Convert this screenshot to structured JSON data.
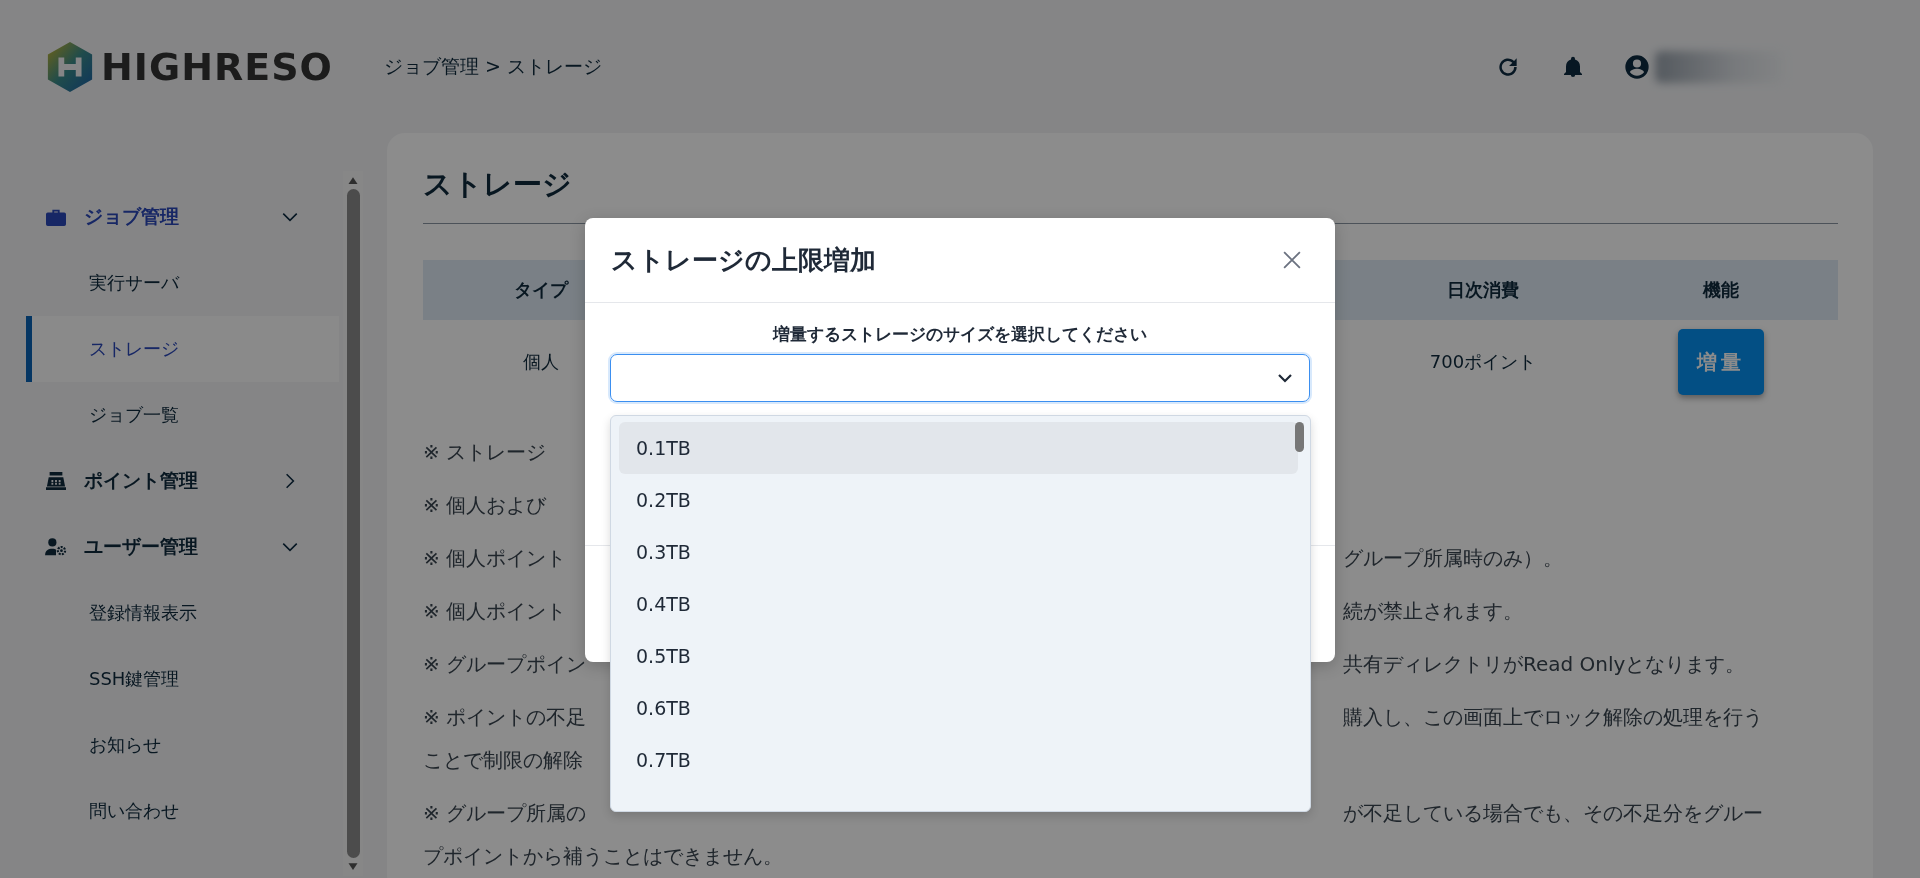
{
  "header": {
    "logo": "HIGHRESO",
    "breadcrumb": "ジョブ管理 > ストレージ"
  },
  "sidebar": {
    "groups": [
      {
        "label": "ジョブ管理",
        "expanded": true,
        "children": [
          {
            "label": "実行サーバ",
            "selected": false
          },
          {
            "label": "ストレージ",
            "selected": true
          },
          {
            "label": "ジョブ一覧",
            "selected": false
          }
        ]
      },
      {
        "label": "ポイント管理",
        "expanded": false
      },
      {
        "label": "ユーザー管理",
        "expanded": true,
        "children": [
          {
            "label": "登録情報表示",
            "selected": false
          },
          {
            "label": "SSH鍵管理",
            "selected": false
          },
          {
            "label": "お知らせ",
            "selected": false
          },
          {
            "label": "問い合わせ",
            "selected": false
          }
        ]
      }
    ]
  },
  "page": {
    "title": "ストレージ",
    "table": {
      "columns": [
        "タイプ",
        "日次消費",
        "機能"
      ],
      "rows": [
        {
          "type": "個人",
          "daily": "700ポイント",
          "button": "増量"
        }
      ]
    },
    "notes": [
      {
        "lines": [
          {
            "left": "※ ストレージ"
          }
        ]
      },
      {
        "lines": [
          {
            "left": "※ 個人および"
          }
        ]
      },
      {
        "lines": [
          {
            "left": "※ 個人ポイント",
            "right": "グループ所属時のみ）。"
          }
        ]
      },
      {
        "lines": [
          {
            "left": "※ 個人ポイント",
            "right": "続が禁止されます。"
          }
        ]
      },
      {
        "lines": [
          {
            "left": "※ グループポイン",
            "right": "共有ディレクトリがRead Onlyとなります。"
          }
        ]
      },
      {
        "lines": [
          {
            "left": "※ ポイントの不足",
            "right": "購入し、この画面上でロック解除の処理を行う"
          },
          {
            "left": "ことで制限の解除"
          }
        ]
      },
      {
        "lines": [
          {
            "left": "※ グループ所属の",
            "right": "が不足している場合でも、その不足分をグルー"
          },
          {
            "left": "プポイントから補うことはできません。"
          }
        ]
      }
    ]
  },
  "modal": {
    "title": "ストレージの上限増加",
    "label": "増量するストレージのサイズを選択してください",
    "options": [
      {
        "label": "0.1TB",
        "selected": true
      },
      {
        "label": "0.2TB",
        "selected": false
      },
      {
        "label": "0.3TB",
        "selected": false
      },
      {
        "label": "0.4TB",
        "selected": false
      },
      {
        "label": "0.5TB",
        "selected": false
      },
      {
        "label": "0.6TB",
        "selected": false
      },
      {
        "label": "0.7TB",
        "selected": false
      }
    ]
  }
}
